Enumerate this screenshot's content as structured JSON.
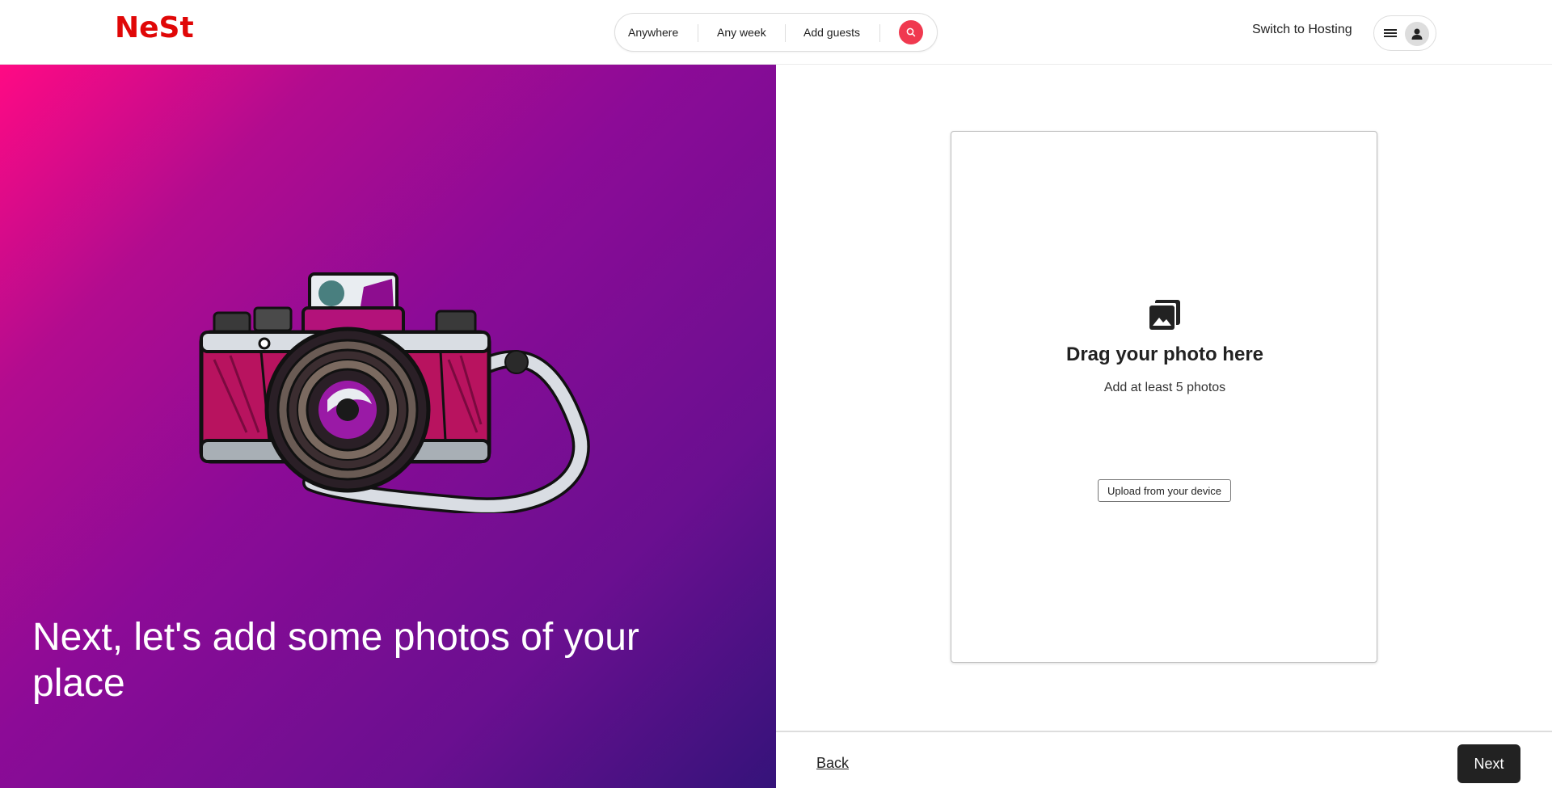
{
  "header": {
    "logo": "NeSt",
    "search": {
      "anywhere": "Anywhere",
      "week": "Any week",
      "guests": "Add guests",
      "search_icon": "search-icon"
    },
    "switch_hosting": "Switch to Hosting",
    "menu_icon": "hamburger-menu-icon",
    "avatar_icon": "user-avatar-icon"
  },
  "hero": {
    "title": "Next, let's add some photos of your place",
    "illustration": "camera-illustration"
  },
  "upload": {
    "icon": "photo-stack-icon",
    "title": "Drag your photo here",
    "subtitle": "Add at least 5 photos",
    "button": "Upload from your device"
  },
  "footer": {
    "back": "Back",
    "next": "Next"
  },
  "colors": {
    "brand": "#e00707",
    "search_button": "#f0394f",
    "next_button": "#222222",
    "hero_gradient_start": "#ff0a84",
    "hero_gradient_end": "#35137a"
  }
}
